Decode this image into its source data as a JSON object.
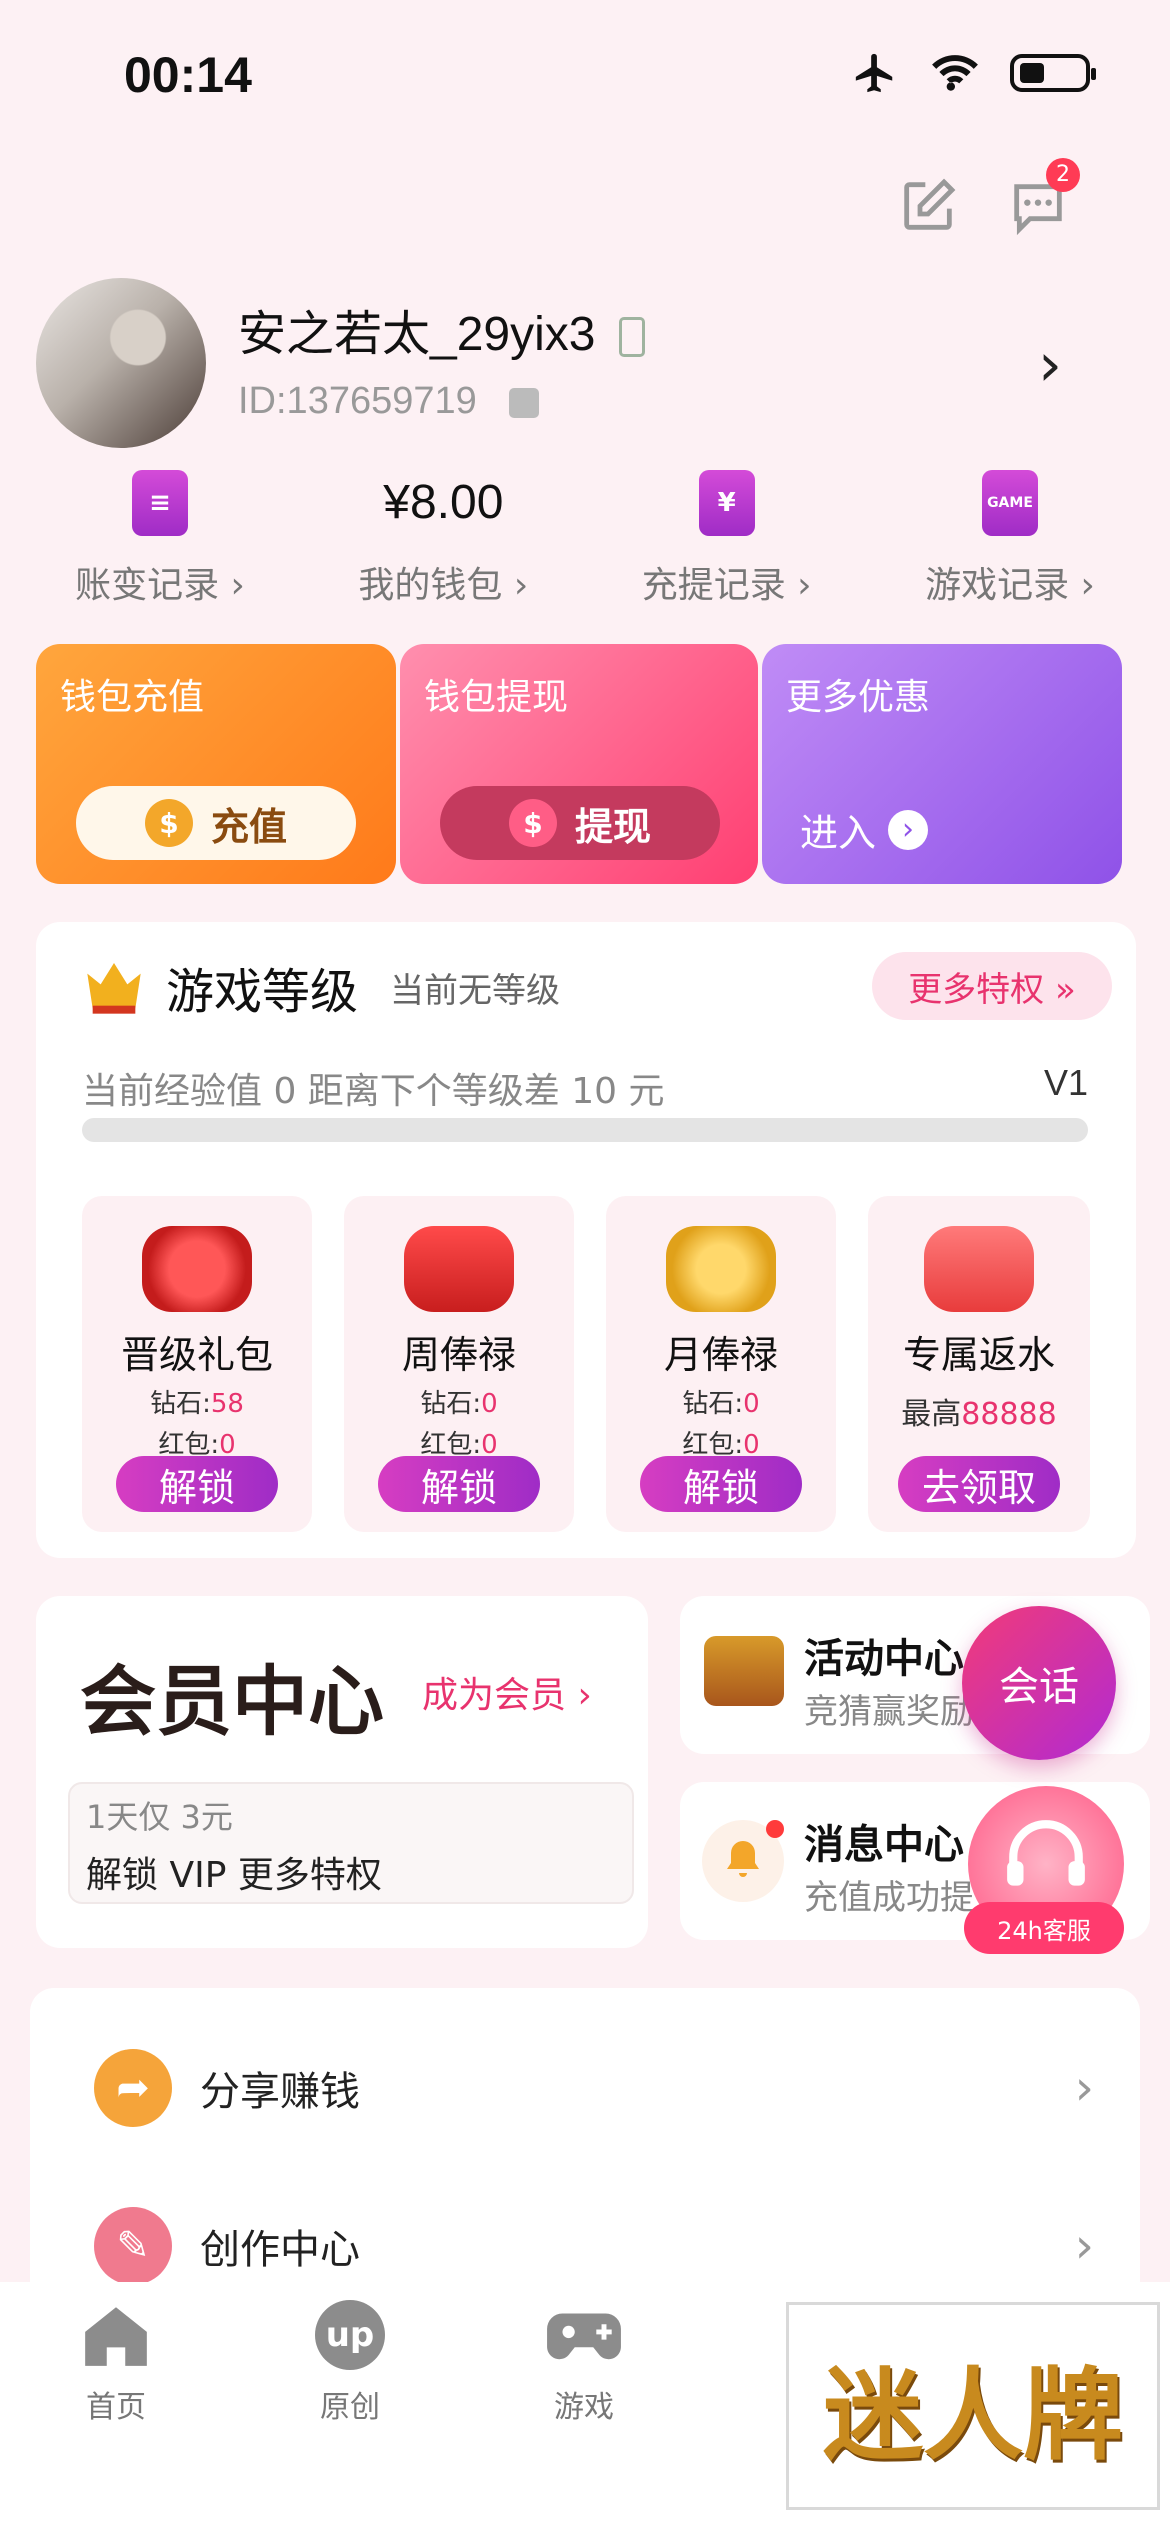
{
  "status_bar": {
    "time": "00:14"
  },
  "header": {
    "message_badge": "2"
  },
  "profile": {
    "username": "安之若太_29yix3",
    "user_id": "ID:137659719"
  },
  "quick_links": [
    {
      "label": "账变记录 ›",
      "icon": "document-icon"
    },
    {
      "label": "我的钱包 ›",
      "value": "¥8.00"
    },
    {
      "label": "充提记录 ›",
      "icon": "yen-icon",
      "icon_text": "¥"
    },
    {
      "label": "游戏记录 ›",
      "icon": "game-icon",
      "icon_text": "GAME"
    }
  ],
  "wallet_cards": [
    {
      "title": "钱包充值",
      "button": "充值",
      "color_from": "#ffa63d",
      "color_to": "#ff7a1a"
    },
    {
      "title": "钱包提现",
      "button": "提现",
      "color_from": "#ff7aa0",
      "color_to": "#ff3f72"
    },
    {
      "title": "更多优惠",
      "button": "进入",
      "color_from": "#b985f5",
      "color_to": "#8f52e8"
    }
  ],
  "game_level": {
    "title": "游戏等级",
    "subtitle": "当前无等级",
    "more_button": "更多特权 »",
    "exp_text": "当前经验值 0 距离下个等级差 10 元",
    "next_level": "V1",
    "progress": 0
  },
  "rewards": [
    {
      "name": "晋级礼包",
      "line1_label": "钻石:",
      "line1_value": "58",
      "line2_label": "红包:",
      "line2_value": "0",
      "button": "解锁"
    },
    {
      "name": "周俸禄",
      "line1_label": "钻石:",
      "line1_value": "0",
      "line2_label": "红包:",
      "line2_value": "0",
      "button": "解锁"
    },
    {
      "name": "月俸禄",
      "line1_label": "钻石:",
      "line1_value": "0",
      "line2_label": "红包:",
      "line2_value": "0",
      "button": "解锁"
    },
    {
      "name": "专属返水",
      "line1_label": "最高",
      "line1_value": "88888",
      "button": "去领取"
    }
  ],
  "vip": {
    "title": "会员中心",
    "join": "成为会员 ›",
    "offer_line1": "1天仅 3元",
    "offer_line2": "解锁 VIP 更多特权"
  },
  "side_cards": [
    {
      "title": "活动中心",
      "subtitle": "竞猜赢奖励"
    },
    {
      "title": "消息中心",
      "subtitle": "充值成功提"
    }
  ],
  "floating": {
    "chat": "会话",
    "service": "24h客服"
  },
  "menu": [
    {
      "label": "分享赚钱",
      "color": "#f5a43a"
    },
    {
      "label": "创作中心",
      "color": "#f07a8e"
    }
  ],
  "tabs": [
    {
      "label": "首页",
      "icon": "home-icon"
    },
    {
      "label": "原创",
      "icon": "up-icon",
      "icon_text": "up"
    },
    {
      "label": "游戏",
      "icon": "gamepad-icon"
    }
  ],
  "brand": {
    "text": "迷人牌"
  }
}
